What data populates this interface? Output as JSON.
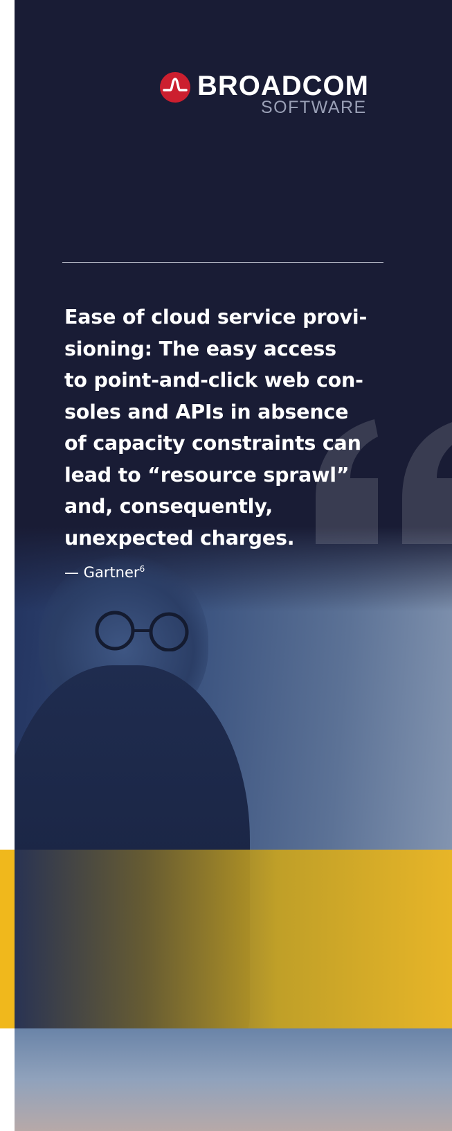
{
  "brand": {
    "name": "BROADCOM",
    "sub": "SOFTWARE",
    "accent_color": "#cc1f2f"
  },
  "quote": {
    "lines": [
      "Ease of cloud service provi-",
      "sioning: The easy access",
      "to point-and-click web con-",
      "soles and APIs in absence",
      "of capacity constraints can",
      "lead to “resource sprawl”",
      "and, consequently,",
      "unexpected charges."
    ],
    "attribution": "— Gartner",
    "footnote": "6"
  },
  "colors": {
    "background": "#191c35",
    "highlight": "#f0b81c"
  },
  "icons": {
    "quote_mark": "quote-mark-icon",
    "logo": "broadcom-logo-icon"
  }
}
